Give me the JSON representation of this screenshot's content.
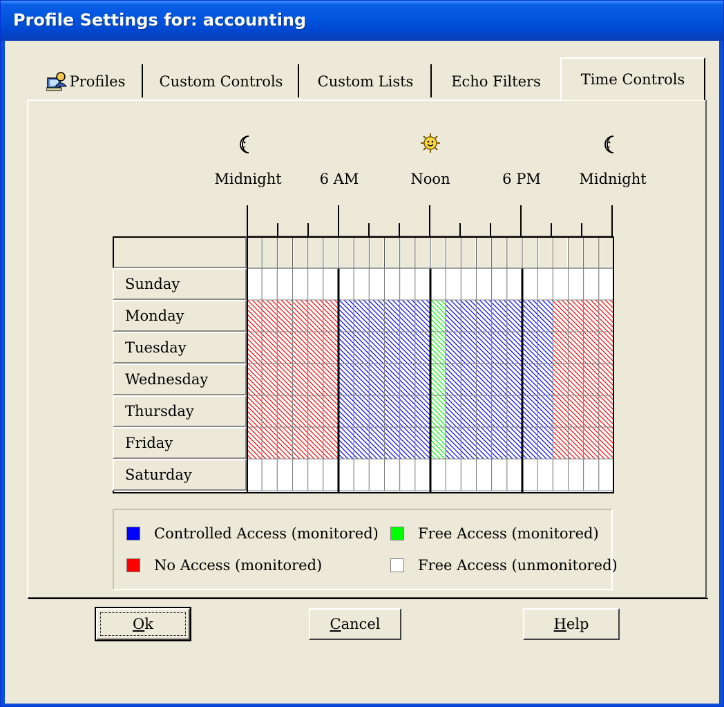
{
  "window": {
    "title": "Profile Settings for: accounting"
  },
  "tabs": [
    {
      "label": "Profiles",
      "icon": "profiles-icon",
      "active": false
    },
    {
      "label": "Custom Controls",
      "active": false
    },
    {
      "label": "Custom Lists",
      "active": false
    },
    {
      "label": "Echo Filters",
      "active": false
    },
    {
      "label": "Time Controls",
      "active": true
    }
  ],
  "time_scale": {
    "icons": [
      "moon-icon",
      "sun-icon",
      "moon-icon"
    ],
    "labels": [
      "Midnight",
      "6 AM",
      "Noon",
      "6 PM",
      "Midnight"
    ]
  },
  "schedule": {
    "days": [
      "Sunday",
      "Monday",
      "Tuesday",
      "Wednesday",
      "Thursday",
      "Friday",
      "Saturday"
    ],
    "slots_per_day": 24,
    "weekday_pattern": "RRRRRRBBBBBBGBBBBBBBRRRR",
    "weekend_pattern": "WWWWWWWWWWWWWWWWWWWWWWWW",
    "colors": {
      "R": "#ff0000",
      "B": "#0000ff",
      "G": "#00ff00",
      "W": "#ffffff"
    }
  },
  "legend": {
    "controlled": {
      "label": "Controlled Access (monitored)",
      "color": "#0000ff"
    },
    "free_monitored": {
      "label": "Free Access (monitored)",
      "color": "#00ff00"
    },
    "no_access": {
      "label": "No Access (monitored)",
      "color": "#ff0000"
    },
    "free_unmonitored": {
      "label": "Free Access (unmonitored)",
      "color": "#ffffff"
    }
  },
  "buttons": {
    "ok": {
      "accel": "O",
      "rest": "k"
    },
    "cancel": {
      "accel": "C",
      "rest": "ancel"
    },
    "help": {
      "accel": "H",
      "rest": "elp"
    }
  }
}
